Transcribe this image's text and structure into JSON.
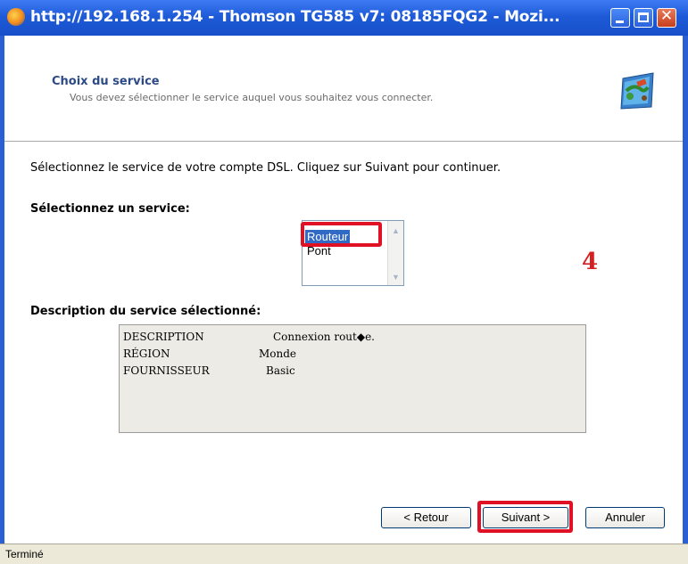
{
  "window": {
    "title": "http://192.168.1.254 - Thomson TG585 v7:  08185FQG2 - Mozi..."
  },
  "header": {
    "title": "Choix du service",
    "subtitle": "Vous devez sélectionner le service auquel vous souhaitez vous connecter."
  },
  "instruction": "Sélectionnez le service de votre compte DSL. Cliquez sur Suivant pour continuer.",
  "service_select": {
    "label": "Sélectionnez un service:",
    "options": [
      "Routeur",
      "Pont"
    ],
    "selected": "Routeur"
  },
  "annotation": {
    "step_number": "4",
    "color": "#e01025"
  },
  "description": {
    "label": "Description du service sélectionné:",
    "rows": [
      {
        "key": "DESCRIPTION",
        "value": "Connexion rout◆e."
      },
      {
        "key": "RÉGION",
        "value": "Monde"
      },
      {
        "key": "FOURNISSEUR",
        "value": "Basic"
      }
    ]
  },
  "buttons": {
    "back": "< Retour",
    "next": "Suivant >",
    "cancel": "Annuler"
  },
  "status": {
    "text": "Terminé"
  },
  "colors": {
    "title_bar": "#1f5bd8",
    "selection": "#316ac5",
    "highlight": "#e01025"
  }
}
